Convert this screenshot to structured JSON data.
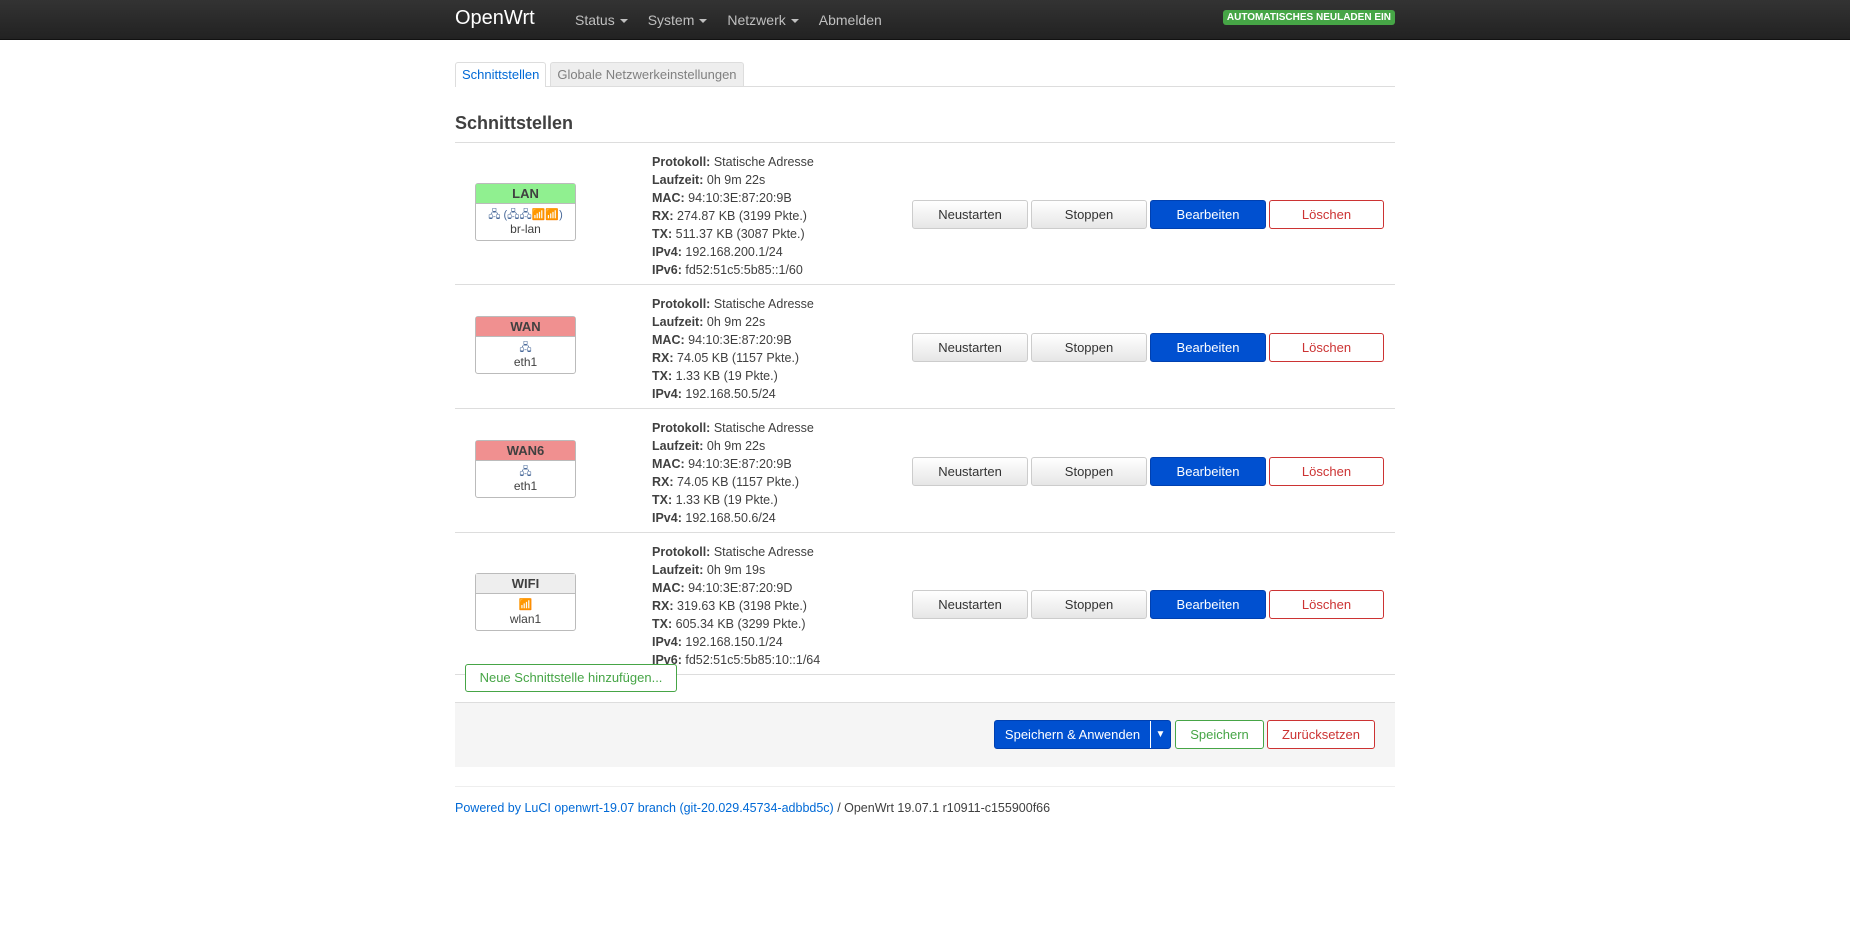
{
  "header": {
    "brand": "OpenWrt",
    "menu": [
      {
        "label": "Status",
        "dropdown": true
      },
      {
        "label": "System",
        "dropdown": true
      },
      {
        "label": "Netzwerk",
        "dropdown": true
      },
      {
        "label": "Abmelden",
        "dropdown": false
      }
    ],
    "autoreload_badge": "AUTOMATISCHES NEULADEN EIN"
  },
  "tabs": [
    {
      "label": "Schnittstellen",
      "active": true
    },
    {
      "label": "Globale Netzwerkeinstellungen",
      "active": false
    }
  ],
  "section_title": "Schnittstellen",
  "labels": {
    "protocol": "Protokoll:",
    "uptime": "Laufzeit:",
    "mac": "MAC:",
    "rx": "RX:",
    "tx": "TX:",
    "ipv4": "IPv4:",
    "ipv6": "IPv6:"
  },
  "buttons": {
    "restart": "Neustarten",
    "stop": "Stoppen",
    "edit": "Bearbeiten",
    "delete": "Löschen"
  },
  "interfaces": [
    {
      "name": "LAN",
      "color": "#90f090",
      "icons": "🖧 (🖧🖧📶📶)",
      "device": "br-lan",
      "protocol": "Statische Adresse",
      "uptime": "0h 9m 22s",
      "mac": "94:10:3E:87:20:9B",
      "rx": "274.87 KB (3199 Pkte.)",
      "tx": "511.37 KB (3087 Pkte.)",
      "ipv4": "192.168.200.1/24",
      "ipv6": "fd52:51c5:5b85::1/60"
    },
    {
      "name": "WAN",
      "color": "#f09090",
      "icons": "🖧",
      "device": "eth1",
      "protocol": "Statische Adresse",
      "uptime": "0h 9m 22s",
      "mac": "94:10:3E:87:20:9B",
      "rx": "74.05 KB (1157 Pkte.)",
      "tx": "1.33 KB (19 Pkte.)",
      "ipv4": "192.168.50.5/24",
      "ipv6": null
    },
    {
      "name": "WAN6",
      "color": "#f09090",
      "icons": "🖧",
      "device": "eth1",
      "protocol": "Statische Adresse",
      "uptime": "0h 9m 22s",
      "mac": "94:10:3E:87:20:9B",
      "rx": "74.05 KB (1157 Pkte.)",
      "tx": "1.33 KB (19 Pkte.)",
      "ipv4": "192.168.50.6/24",
      "ipv6": null
    },
    {
      "name": "WIFI",
      "color": "#eeeeee",
      "icons": "📶",
      "device": "wlan1",
      "protocol": "Statische Adresse",
      "uptime": "0h 9m 19s",
      "mac": "94:10:3E:87:20:9D",
      "rx": "319.63 KB (3198 Pkte.)",
      "tx": "605.34 KB (3299 Pkte.)",
      "ipv4": "192.168.150.1/24",
      "ipv6": "fd52:51c5:5b85:10::1/64"
    }
  ],
  "add_interface": "Neue Schnittstelle hinzufügen...",
  "actions": {
    "save_apply": "Speichern & Anwenden",
    "save": "Speichern",
    "reset": "Zurücksetzen"
  },
  "footer": {
    "link": "Powered by LuCI openwrt-19.07 branch (git-20.029.45734-adbbd5c)",
    "version": " / OpenWrt 19.07.1 r10911-c155900f66"
  }
}
